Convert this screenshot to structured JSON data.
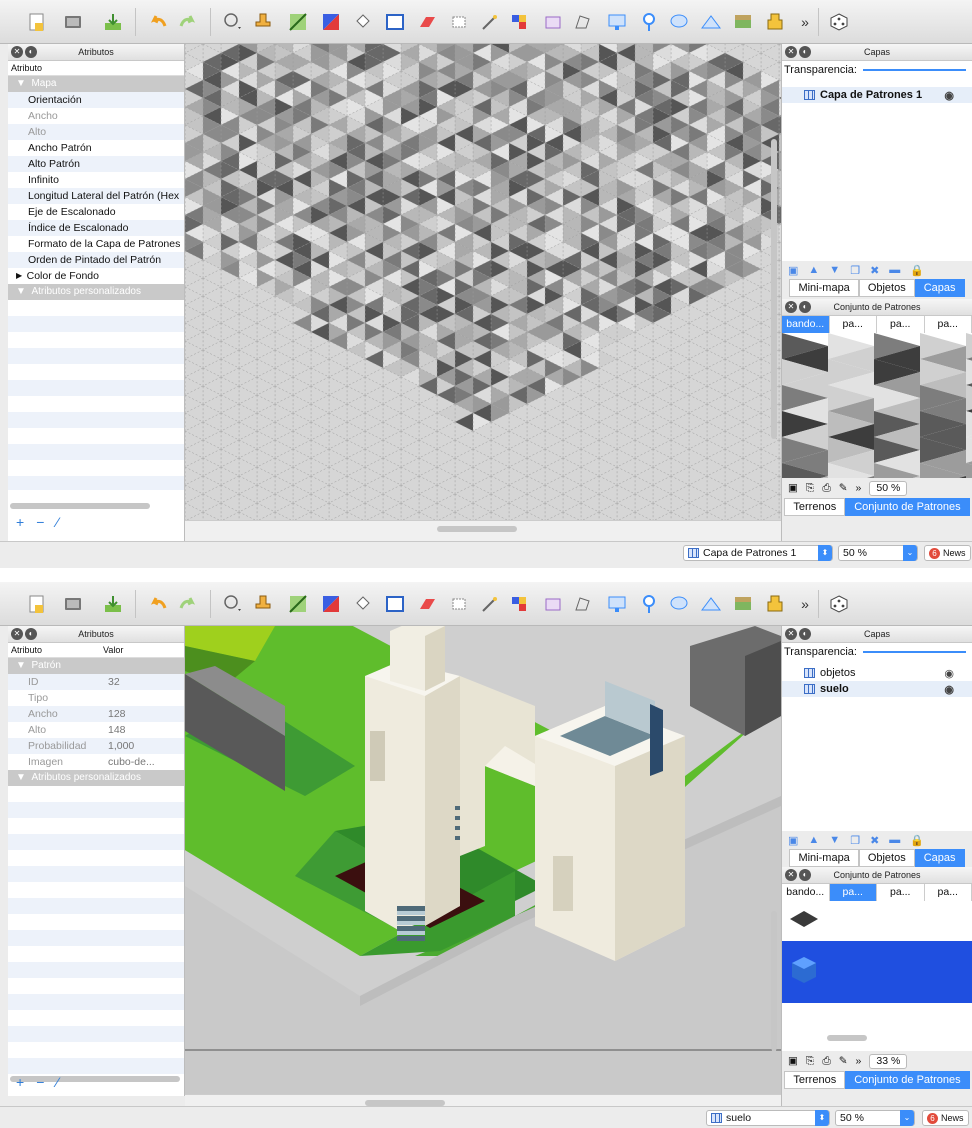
{
  "toolbar": {
    "icons": [
      "new-map-icon",
      "open-icon",
      "save-icon",
      "undo-icon",
      "redo-icon",
      "stamp-dropdown-icon",
      "stamp-brush-icon",
      "terrain-brush-icon",
      "wang-brush-icon",
      "bucket-fill-icon",
      "shape-fill-icon",
      "eraser-icon",
      "rectangle-select-icon",
      "magic-wand-icon",
      "select-same-tile-icon",
      "select-objects-icon",
      "edit-polygons-icon",
      "insert-rectangle-icon",
      "insert-point-icon",
      "insert-ellipse-icon",
      "insert-polygon-icon",
      "insert-tile-icon",
      "insert-template-icon",
      "random-mode-icon"
    ],
    "overflow": "»"
  },
  "window1": {
    "attributes_panel": {
      "title": "Atributos",
      "col_attr": "Atributo",
      "group_map": "Mapa",
      "rows": [
        {
          "label": "Orientación",
          "dim": false
        },
        {
          "label": "Ancho",
          "dim": true
        },
        {
          "label": "Alto",
          "dim": true
        },
        {
          "label": "Ancho Patrón",
          "dim": false
        },
        {
          "label": "Alto Patrón",
          "dim": false
        },
        {
          "label": "Infinito",
          "dim": false
        },
        {
          "label": "Longitud Lateral del Patrón (Hex",
          "dim": false
        },
        {
          "label": "Eje de Escalonado",
          "dim": false
        },
        {
          "label": "Índice de Escalonado",
          "dim": false
        },
        {
          "label": "Formato de la Capa de Patrones",
          "dim": false
        },
        {
          "label": "Orden de Pintado del Patrón",
          "dim": false
        },
        {
          "label": "Color de Fondo",
          "dim": false
        }
      ],
      "group_custom": "Atributos personalizados"
    },
    "layers_panel": {
      "title": "Capas",
      "transparency": "Transparencia:",
      "layers": [
        "Capa de Patrones 1"
      ]
    },
    "tabs": [
      "Mini-mapa",
      "Objetos",
      "Capas"
    ],
    "tileset_panel": {
      "title": "Conjunto de Patrones",
      "tilesets": [
        "bando...",
        "pa...",
        "pa...",
        "pa..."
      ],
      "zoom": "50 %",
      "bottom_tabs": [
        "Terrenos",
        "Conjunto de Patrones"
      ]
    },
    "status": {
      "layer": "Capa de Patrones 1",
      "zoom": "50 %",
      "news": "News"
    }
  },
  "window2": {
    "attributes_panel": {
      "title": "Atributos",
      "col_attr": "Atributo",
      "col_value": "Valor",
      "group_tile": "Patrón",
      "rows": [
        {
          "label": "ID",
          "value": "32"
        },
        {
          "label": "Tipo",
          "value": ""
        },
        {
          "label": "Ancho",
          "value": "128"
        },
        {
          "label": "Alto",
          "value": "148"
        },
        {
          "label": "Probabilidad",
          "value": "1,000"
        },
        {
          "label": "Imagen",
          "value": "cubo-de..."
        }
      ],
      "group_custom": "Atributos personalizados"
    },
    "layers_panel": {
      "title": "Capas",
      "transparency": "Transparencia:",
      "layers": [
        "objetos",
        "suelo"
      ]
    },
    "tabs": [
      "Mini-mapa",
      "Objetos",
      "Capas"
    ],
    "tileset_panel": {
      "title": "Conjunto de Patrones",
      "tilesets": [
        "bando...",
        "pa...",
        "pa...",
        "pa..."
      ],
      "zoom": "33 %",
      "bottom_tabs": [
        "Terrenos",
        "Conjunto de Patrones"
      ]
    },
    "status": {
      "layer": "suelo",
      "zoom": "50 %",
      "news": "News"
    }
  },
  "colors": {
    "accent": "#3b8dfa",
    "grass": "#5fbd2c",
    "dark_grass": "#2f8a2a",
    "stone": "#efebde"
  }
}
